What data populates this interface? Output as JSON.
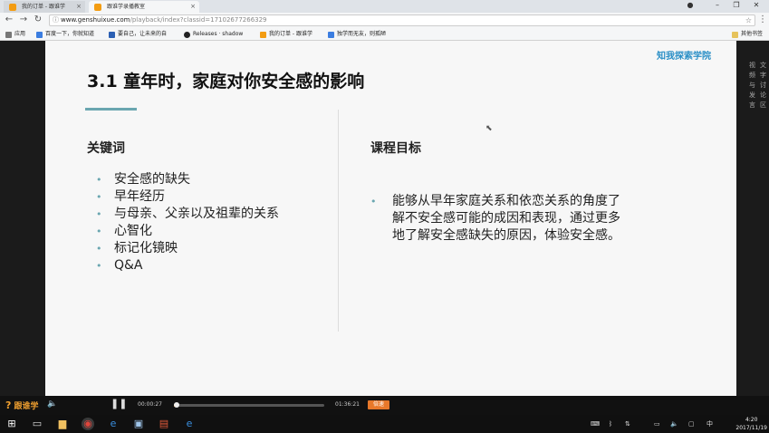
{
  "tabs": [
    {
      "title": "我的订单 - 跟谁学"
    },
    {
      "title": "跟谁学录播教室"
    }
  ],
  "address": {
    "host": "www.genshuixue.com",
    "path": "/playback/index?classid=17102677266329"
  },
  "bookmarks": {
    "apps_label": "应用",
    "items": [
      {
        "label": "百度一下，你就知道",
        "color": "#3b7de0"
      },
      {
        "label": "要自己，让未来的自",
        "color": "#2b5fb3"
      },
      {
        "label": "Releases · shadow",
        "color": "#222222"
      },
      {
        "label": "我的订单 - 跟谁学",
        "color": "#f39c12"
      },
      {
        "label": "独学而无友，则孤陋",
        "color": "#3b7de0"
      }
    ],
    "other_label": "其他书签"
  },
  "slide": {
    "title": "3.1 童年时，家庭对你安全感的影响",
    "brand": "知我探索学院",
    "keywords_heading": "关键词",
    "keywords": [
      "安全感的缺失",
      "早年经历",
      "与母亲、父亲以及祖辈的关系",
      "心智化",
      "标记化镜映",
      "Q&A"
    ],
    "goals_heading": "课程目标",
    "goal_text": "能够从早年家庭关系和依恋关系的角度了解不安全感可能的成因和表现，通过更多地了解安全感缺失的原因，体验安全感。"
  },
  "side_panel": {
    "col1": "视频与发言",
    "col2": "文字讨论区"
  },
  "player": {
    "logo": "跟谁学",
    "current_time": "00:00:27",
    "total_time": "01:36:21",
    "progress": 0.005,
    "speed_label": "倍速"
  },
  "taskbar": {
    "time": "4:20",
    "date": "2017/11/19",
    "ime": "中"
  },
  "colors": {
    "accent": "#6aa6b0",
    "brand_orange": "#e8782a"
  }
}
